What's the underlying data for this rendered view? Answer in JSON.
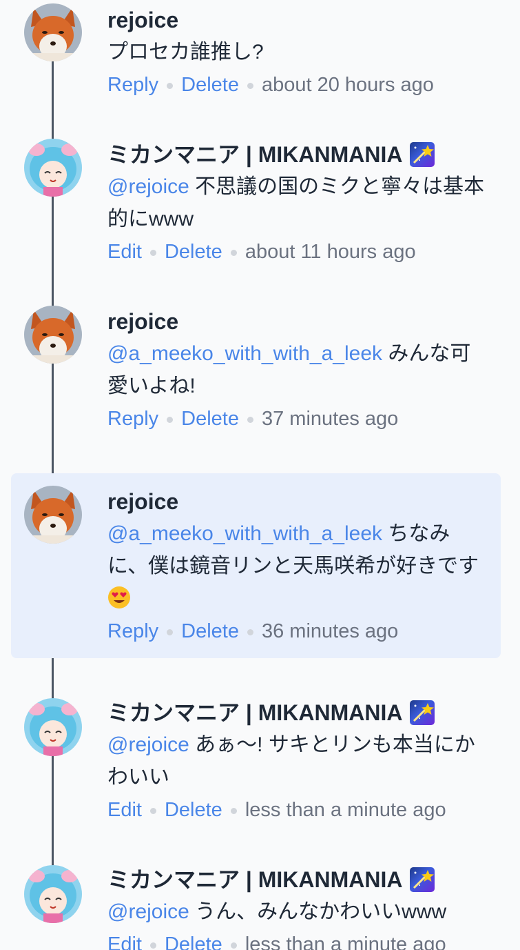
{
  "comments": [
    {
      "author": "rejoice",
      "mention": "",
      "text": "プロセカ誰推し?",
      "action1": "Reply",
      "action2": "Delete",
      "time": "about 20 hours ago"
    },
    {
      "author": "ミカンマニア | MIKANMANIA",
      "mention": "@rejoice",
      "text": "不思議の国のミクと寧々は基本的にwww",
      "action1": "Edit",
      "action2": "Delete",
      "time": "about 11 hours ago"
    },
    {
      "author": "rejoice",
      "mention": "@a_meeko_with_with_a_leek",
      "text": "みんな可愛いよね!",
      "action1": "Reply",
      "action2": "Delete",
      "time": "37 minutes ago"
    },
    {
      "author": "rejoice",
      "mention": "@a_meeko_with_with_a_leek",
      "text": "ちなみに、僕は鏡音リンと天馬咲希が好きです",
      "action1": "Reply",
      "action2": "Delete",
      "time": "36 minutes ago"
    },
    {
      "author": "ミカンマニア | MIKANMANIA",
      "mention": "@rejoice",
      "text": "あぁ〜!  サキとリンも本当にかわいい",
      "action1": "Edit",
      "action2": "Delete",
      "time": "less than a minute ago"
    },
    {
      "author": "ミカンマニア | MIKANMANIA",
      "mention": "@rejoice",
      "text": "うん、みんなかわいいwww",
      "action1": "Edit",
      "action2": "Delete",
      "time": "less than a minute ago"
    }
  ],
  "icons": {
    "user_avatar": "fox-avatar",
    "other_avatar": "anime-girl-avatar",
    "author_badge": "shooting-star-badge-icon",
    "heart_eyes": "heart-eyes-emoji"
  },
  "colors": {
    "link": "#4a86e8",
    "highlight": "#e8effc",
    "thread_line": "#4b5563"
  }
}
